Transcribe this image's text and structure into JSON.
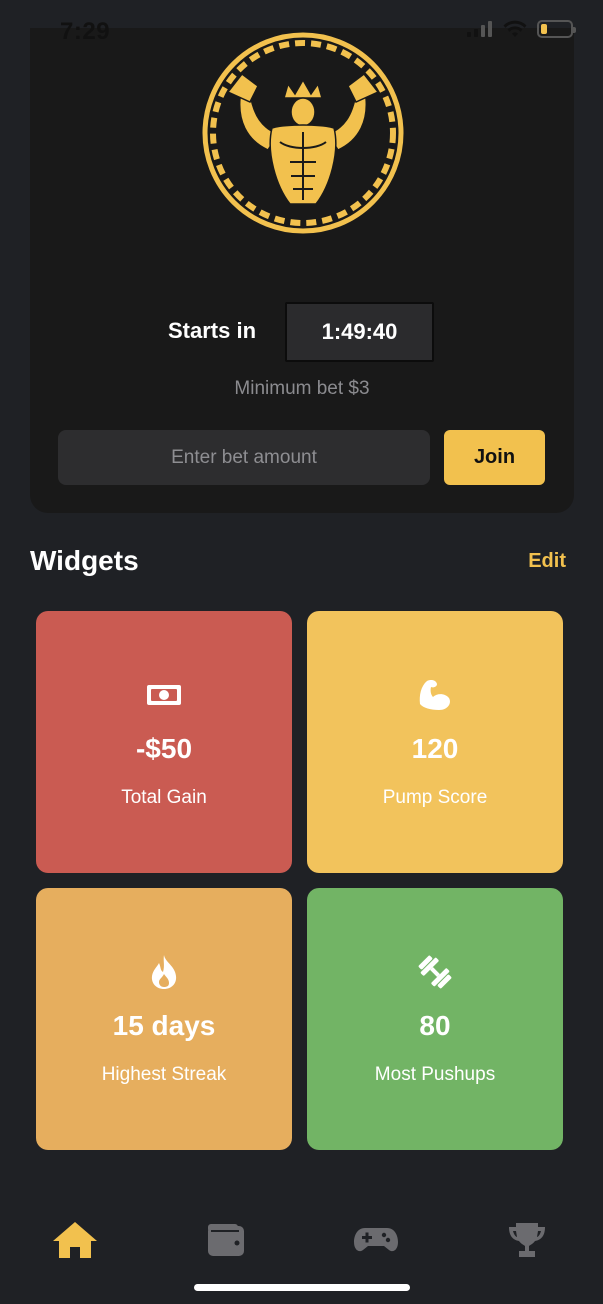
{
  "status_bar": {
    "time": "7:29",
    "battery_color": "#f2c14e"
  },
  "tournament": {
    "logo_icon": "muscle-king-chain-logo",
    "starts_label": "Starts in",
    "timer": "1:49:40",
    "minimum_bet": "Minimum bet $3",
    "bet_input_placeholder": "Enter bet amount",
    "bet_input_value": "",
    "join_label": "Join"
  },
  "widgets": {
    "title": "Widgets",
    "edit_label": "Edit",
    "tiles": [
      {
        "icon": "money-bill-icon",
        "value": "-$50",
        "label": "Total Gain",
        "color": "#ca5b52"
      },
      {
        "icon": "flexed-bicep-icon",
        "value": "120",
        "label": "Pump Score",
        "color": "#f2c35c"
      },
      {
        "icon": "flame-icon",
        "value": "15 days",
        "label": "Highest Streak",
        "color": "#e6ae5e"
      },
      {
        "icon": "dumbbell-icon",
        "value": "80",
        "label": "Most Pushups",
        "color": "#72b465"
      }
    ]
  },
  "tab_bar": {
    "active_color": "#f2c14e",
    "inactive_color": "#6b6b6f",
    "tabs": [
      {
        "icon": "home-icon",
        "active": true
      },
      {
        "icon": "wallet-icon",
        "active": false
      },
      {
        "icon": "gamepad-icon",
        "active": false
      },
      {
        "icon": "trophy-icon",
        "active": false
      }
    ]
  }
}
